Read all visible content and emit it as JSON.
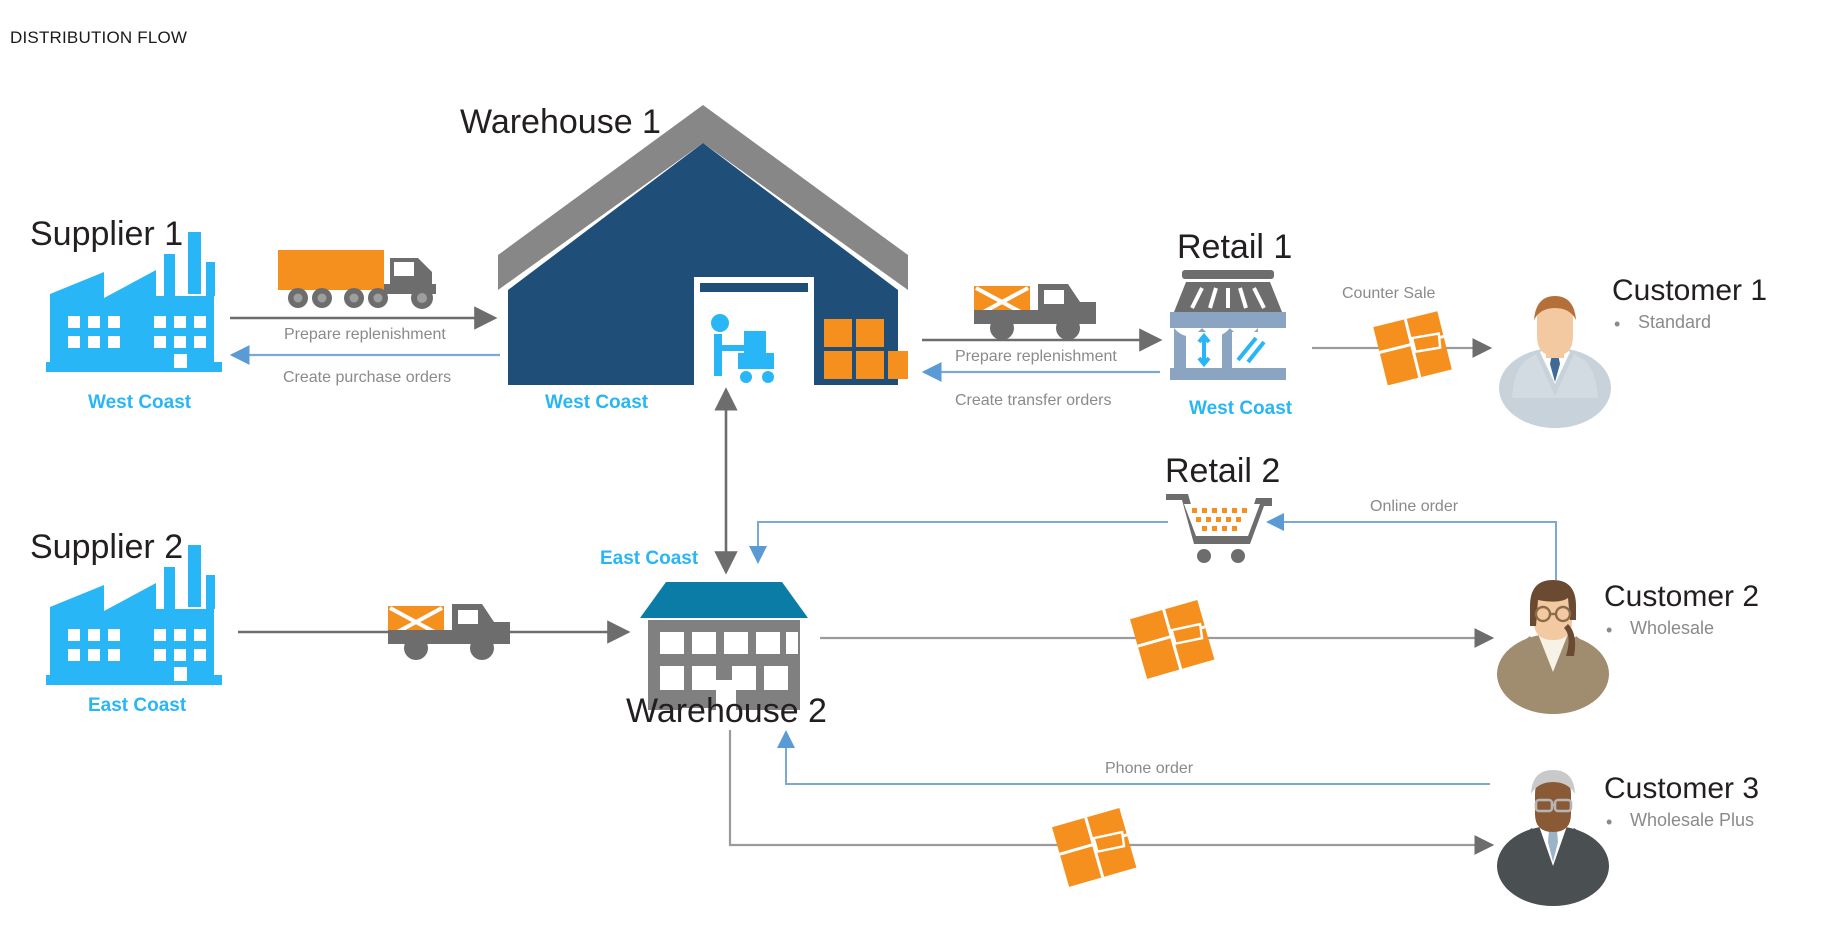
{
  "title": "DISTRIBUTION FLOW",
  "colors": {
    "cyan": "#29b6f6",
    "orange": "#f5901f",
    "warehouse1_blue": "#1f4e79",
    "warehouse1_roof_gray": "#878787",
    "warehouse2_gray": "#808080",
    "warehouse2_roof_teal": "#0a7ca5",
    "arrow_gray": "#6d6d6d",
    "arrow_blue": "#7aa9d6",
    "label_gray": "#8a8a8a",
    "text_black": "#231f20",
    "retail_blue_gray": "#8ba4c1"
  },
  "nodes": {
    "supplier1": {
      "title": "Supplier 1",
      "region": "West Coast",
      "icon": "factory-icon"
    },
    "supplier2": {
      "title": "Supplier 2",
      "region": "East Coast",
      "icon": "factory-icon"
    },
    "warehouse1": {
      "title": "Warehouse 1",
      "region": "West Coast",
      "icon": "warehouse-building-icon"
    },
    "warehouse2": {
      "title": "Warehouse 2",
      "region": "East Coast",
      "icon": "warehouse-building-icon"
    },
    "retail1": {
      "title": "Retail 1",
      "region": "West Coast",
      "icon": "storefront-icon"
    },
    "retail2": {
      "title": "Retail 2",
      "region": "",
      "icon": "shopping-cart-icon"
    },
    "customer1": {
      "title": "Customer 1",
      "type": "Standard",
      "icon": "avatar-male-icon"
    },
    "customer2": {
      "title": "Customer 2",
      "type": "Wholesale",
      "icon": "avatar-female-icon"
    },
    "customer3": {
      "title": "Customer 3",
      "type": "Wholesale Plus",
      "icon": "avatar-senior-male-icon"
    }
  },
  "flows": {
    "supplier1_to_wh1_top": "Prepare replenishment",
    "supplier1_to_wh1_bottom": "Create purchase orders",
    "wh1_to_retail1_top": "Prepare replenishment",
    "wh1_to_retail1_bottom": "Create transfer orders",
    "retail1_to_customer1": "Counter Sale",
    "customer2_to_retail2": "Online order",
    "customer3_to_wh2": "Phone order"
  },
  "chart_data": {
    "type": "diagram",
    "title": "DISTRIBUTION FLOW",
    "nodes": [
      {
        "id": "supplier1",
        "label": "Supplier 1",
        "region": "West Coast",
        "kind": "supplier"
      },
      {
        "id": "supplier2",
        "label": "Supplier 2",
        "region": "East Coast",
        "kind": "supplier"
      },
      {
        "id": "warehouse1",
        "label": "Warehouse 1",
        "region": "West Coast",
        "kind": "warehouse"
      },
      {
        "id": "warehouse2",
        "label": "Warehouse 2",
        "region": "East Coast",
        "kind": "warehouse"
      },
      {
        "id": "retail1",
        "label": "Retail 1",
        "region": "West Coast",
        "kind": "retail"
      },
      {
        "id": "retail2",
        "label": "Retail 2",
        "region": "",
        "kind": "retail"
      },
      {
        "id": "customer1",
        "label": "Customer 1",
        "type": "Standard",
        "kind": "customer"
      },
      {
        "id": "customer2",
        "label": "Customer 2",
        "type": "Wholesale",
        "kind": "customer"
      },
      {
        "id": "customer3",
        "label": "Customer 3",
        "type": "Wholesale Plus",
        "kind": "customer"
      }
    ],
    "edges": [
      {
        "from": "supplier1",
        "to": "warehouse1",
        "label": "Prepare replenishment",
        "color": "gray"
      },
      {
        "from": "warehouse1",
        "to": "supplier1",
        "label": "Create purchase orders",
        "color": "blue"
      },
      {
        "from": "warehouse1",
        "to": "retail1",
        "label": "Prepare replenishment",
        "color": "gray"
      },
      {
        "from": "retail1",
        "to": "warehouse1",
        "label": "Create transfer orders",
        "color": "blue"
      },
      {
        "from": "retail1",
        "to": "customer1",
        "label": "Counter Sale",
        "color": "gray"
      },
      {
        "from": "warehouse1",
        "to": "warehouse2",
        "label": "",
        "color": "gray"
      },
      {
        "from": "supplier2",
        "to": "warehouse2",
        "label": "",
        "color": "gray"
      },
      {
        "from": "warehouse2",
        "to": "customer2",
        "label": "",
        "color": "gray"
      },
      {
        "from": "customer2",
        "to": "retail2",
        "label": "Online order",
        "color": "blue"
      },
      {
        "from": "retail2",
        "to": "warehouse2",
        "label": "",
        "color": "blue"
      },
      {
        "from": "customer3",
        "to": "warehouse2",
        "label": "Phone order",
        "color": "blue"
      },
      {
        "from": "warehouse2",
        "to": "customer3",
        "label": "",
        "color": "gray"
      }
    ]
  }
}
